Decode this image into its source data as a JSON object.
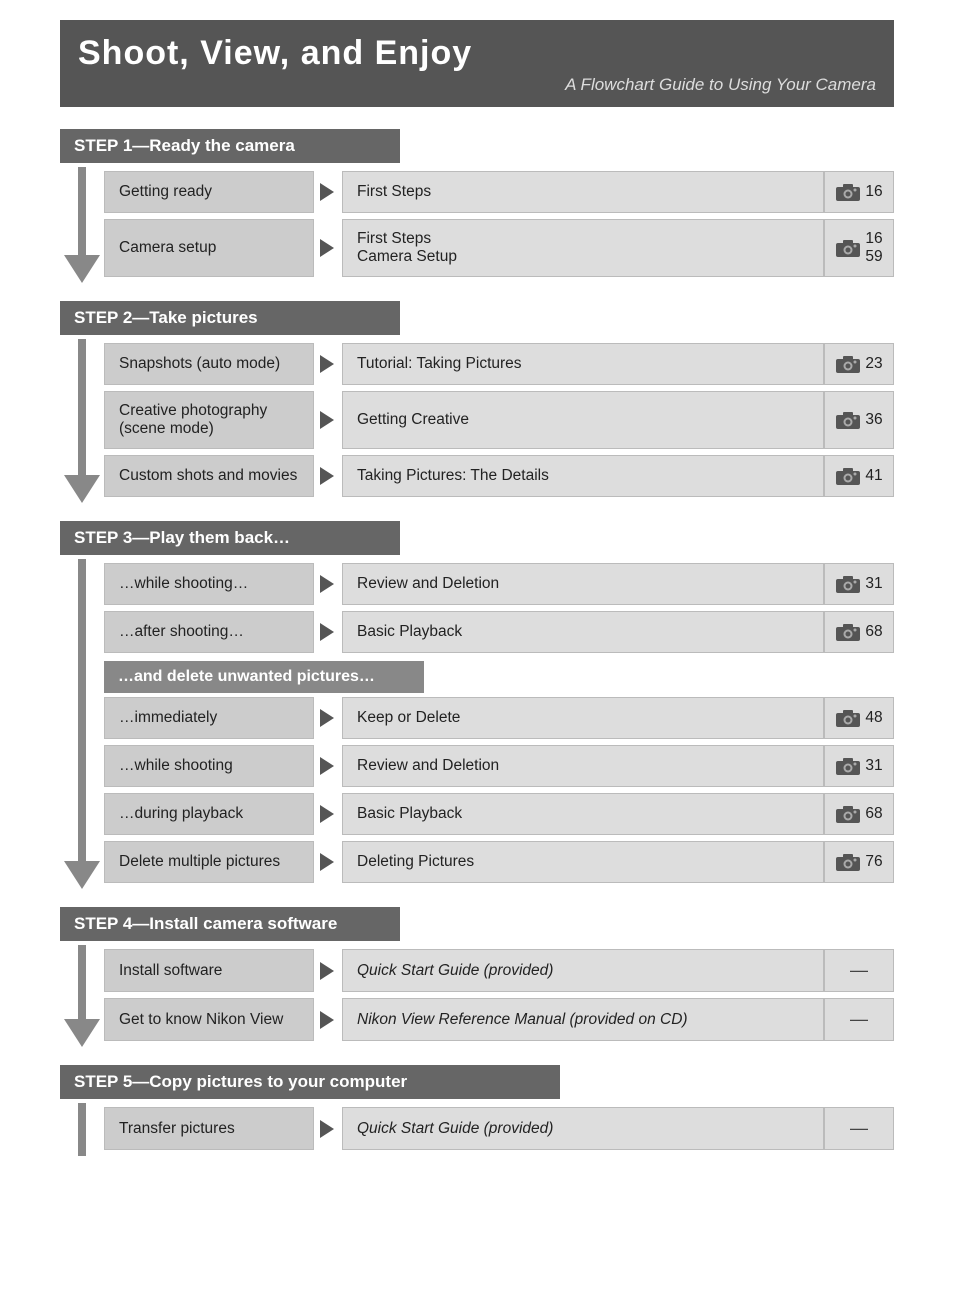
{
  "header": {
    "title": "Shoot, View, and Enjoy",
    "subtitle": "A Flowchart Guide to Using Your Camera"
  },
  "steps": [
    {
      "id": "step1",
      "label": "STEP 1—Ready the camera",
      "rows": [
        {
          "left": "Getting ready",
          "middle": "First Steps",
          "page": "16",
          "has_icon": true
        },
        {
          "left": "Camera setup",
          "middle": "First Steps\nCamera Setup",
          "page": "16\n59",
          "has_icon": true
        }
      ]
    },
    {
      "id": "step2",
      "label": "STEP 2—Take pictures",
      "rows": [
        {
          "left": "Snapshots (auto mode)",
          "middle": "Tutorial: Taking Pictures",
          "page": "23",
          "has_icon": true
        },
        {
          "left": "Creative photography\n(scene mode)",
          "middle": "Getting Creative",
          "page": "36",
          "has_icon": true
        },
        {
          "left": "Custom shots and movies",
          "middle": "Taking Pictures: The Details",
          "page": "41",
          "has_icon": true
        }
      ]
    },
    {
      "id": "step3",
      "label": "STEP 3—Play them back…",
      "rows": [
        {
          "left": "…while shooting…",
          "middle": "Review and Deletion",
          "page": "31",
          "has_icon": true
        },
        {
          "left": "…after shooting…",
          "middle": "Basic Playback",
          "page": "68",
          "has_icon": true
        }
      ],
      "sub": {
        "label": "…and delete unwanted pictures…",
        "rows": [
          {
            "left": "…immediately",
            "middle": "Keep or Delete",
            "page": "48",
            "has_icon": true
          },
          {
            "left": "…while shooting",
            "middle": "Review and Deletion",
            "page": "31",
            "has_icon": true
          },
          {
            "left": "…during playback",
            "middle": "Basic Playback",
            "page": "68",
            "has_icon": true
          },
          {
            "left": "Delete multiple pictures",
            "middle": "Deleting Pictures",
            "page": "76",
            "has_icon": true
          }
        ]
      }
    },
    {
      "id": "step4",
      "label": "STEP 4—Install camera software",
      "rows": [
        {
          "left": "Install software",
          "middle": "Quick Start Guide (provided)",
          "page": "—",
          "has_icon": false,
          "italic": true
        },
        {
          "left": "Get to know Nikon View",
          "middle": "Nikon View Reference Manual (provided on CD)",
          "page": "—",
          "has_icon": false,
          "italic": true
        }
      ]
    },
    {
      "id": "step5",
      "label": "STEP 5—Copy pictures to your computer",
      "rows": [
        {
          "left": "Transfer pictures",
          "middle": "Quick Start Guide (provided)",
          "page": "—",
          "has_icon": false,
          "italic": true
        }
      ]
    }
  ]
}
